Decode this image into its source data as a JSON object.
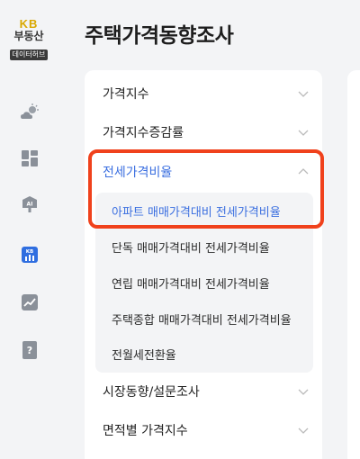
{
  "logo": {
    "kb": "KB",
    "main": "부동산",
    "sub": "데이터허브"
  },
  "page_title": "주택가격동향조사",
  "rail_icons": [
    "weather-icon",
    "dashboard-icon",
    "ai-icon",
    "kb-chart-icon",
    "trend-icon",
    "help-book-icon"
  ],
  "menu": {
    "items": [
      {
        "label": "가격지수",
        "expanded": false
      },
      {
        "label": "가격지수증감률",
        "expanded": false
      },
      {
        "label": "전세가격비율",
        "expanded": true
      },
      {
        "label": "시장동향/설문조사",
        "expanded": false
      },
      {
        "label": "면적별 가격지수",
        "expanded": false
      }
    ],
    "submenu": [
      {
        "label": "아파트 매매가격대비 전세가격비율",
        "selected": true
      },
      {
        "label": "단독 매매가격대비 전세가격비율",
        "selected": false
      },
      {
        "label": "연립 매매가격대비 전세가격비율",
        "selected": false
      },
      {
        "label": "주택종합 매매가격대비 전세가격비율",
        "selected": false
      },
      {
        "label": "전월세전환율",
        "selected": false
      }
    ]
  },
  "colors": {
    "accent": "#3b6fe0",
    "highlight": "#f0411c",
    "background": "#f3f4f6",
    "logo_gold": "#d9a800"
  }
}
